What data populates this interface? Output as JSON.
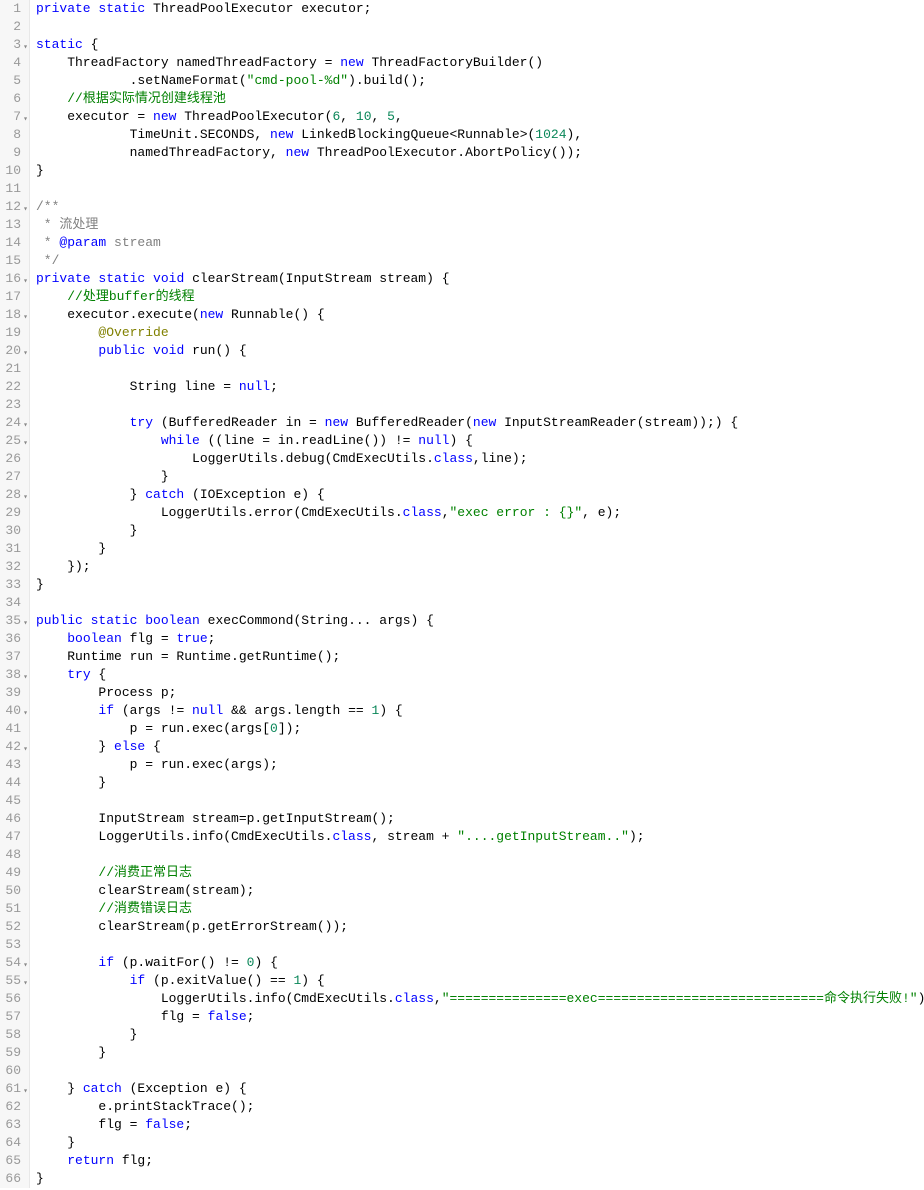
{
  "lines": [
    {
      "n": 1,
      "fold": "",
      "seg": [
        [
          "kw",
          "private"
        ],
        [
          "id",
          " "
        ],
        [
          "kw",
          "static"
        ],
        [
          "id",
          " ThreadPoolExecutor executor;"
        ]
      ]
    },
    {
      "n": 2,
      "fold": "",
      "seg": [
        [
          "id",
          ""
        ]
      ]
    },
    {
      "n": 3,
      "fold": "▾",
      "seg": [
        [
          "kw",
          "static"
        ],
        [
          "id",
          " {"
        ]
      ]
    },
    {
      "n": 4,
      "fold": "",
      "seg": [
        [
          "id",
          "    ThreadFactory namedThreadFactory = "
        ],
        [
          "kw",
          "new"
        ],
        [
          "id",
          " ThreadFactoryBuilder()"
        ]
      ]
    },
    {
      "n": 5,
      "fold": "",
      "seg": [
        [
          "id",
          "            .setNameFormat("
        ],
        [
          "str",
          "\"cmd-pool-%d\""
        ],
        [
          "id",
          ").build();"
        ]
      ]
    },
    {
      "n": 6,
      "fold": "",
      "seg": [
        [
          "id",
          "    "
        ],
        [
          "cmt",
          "//根据实际情况创建线程池"
        ]
      ]
    },
    {
      "n": 7,
      "fold": "▾",
      "seg": [
        [
          "id",
          "    executor = "
        ],
        [
          "kw",
          "new"
        ],
        [
          "id",
          " ThreadPoolExecutor("
        ],
        [
          "num",
          "6"
        ],
        [
          "id",
          ", "
        ],
        [
          "num",
          "10"
        ],
        [
          "id",
          ", "
        ],
        [
          "num",
          "5"
        ],
        [
          "id",
          ","
        ]
      ]
    },
    {
      "n": 8,
      "fold": "",
      "seg": [
        [
          "id",
          "            TimeUnit.SECONDS, "
        ],
        [
          "kw",
          "new"
        ],
        [
          "id",
          " LinkedBlockingQueue<Runnable>("
        ],
        [
          "num",
          "1024"
        ],
        [
          "id",
          "),"
        ]
      ]
    },
    {
      "n": 9,
      "fold": "",
      "seg": [
        [
          "id",
          "            namedThreadFactory, "
        ],
        [
          "kw",
          "new"
        ],
        [
          "id",
          " ThreadPoolExecutor.AbortPolicy());"
        ]
      ]
    },
    {
      "n": 10,
      "fold": "",
      "seg": [
        [
          "id",
          "}"
        ]
      ]
    },
    {
      "n": 11,
      "fold": "",
      "seg": [
        [
          "id",
          ""
        ]
      ]
    },
    {
      "n": 12,
      "fold": "▾",
      "seg": [
        [
          "doc",
          "/**"
        ]
      ]
    },
    {
      "n": 13,
      "fold": "",
      "seg": [
        [
          "doc",
          " * 流处理"
        ]
      ]
    },
    {
      "n": 14,
      "fold": "",
      "seg": [
        [
          "doc",
          " * "
        ],
        [
          "doctag",
          "@param"
        ],
        [
          "doc",
          " stream"
        ]
      ]
    },
    {
      "n": 15,
      "fold": "",
      "seg": [
        [
          "doc",
          " */"
        ]
      ]
    },
    {
      "n": 16,
      "fold": "▾",
      "seg": [
        [
          "kw",
          "private"
        ],
        [
          "id",
          " "
        ],
        [
          "kw",
          "static"
        ],
        [
          "id",
          " "
        ],
        [
          "kw",
          "void"
        ],
        [
          "id",
          " clearStream(InputStream stream) {"
        ]
      ]
    },
    {
      "n": 17,
      "fold": "",
      "seg": [
        [
          "id",
          "    "
        ],
        [
          "cmt",
          "//处理buffer的线程"
        ]
      ]
    },
    {
      "n": 18,
      "fold": "▾",
      "seg": [
        [
          "id",
          "    executor.execute("
        ],
        [
          "kw",
          "new"
        ],
        [
          "id",
          " Runnable() {"
        ]
      ]
    },
    {
      "n": 19,
      "fold": "",
      "seg": [
        [
          "id",
          "        "
        ],
        [
          "ann",
          "@Override"
        ]
      ]
    },
    {
      "n": 20,
      "fold": "▾",
      "seg": [
        [
          "id",
          "        "
        ],
        [
          "kw",
          "public"
        ],
        [
          "id",
          " "
        ],
        [
          "kw",
          "void"
        ],
        [
          "id",
          " run() {"
        ]
      ]
    },
    {
      "n": 21,
      "fold": "",
      "seg": [
        [
          "id",
          ""
        ]
      ]
    },
    {
      "n": 22,
      "fold": "",
      "seg": [
        [
          "id",
          "            String line = "
        ],
        [
          "kw",
          "null"
        ],
        [
          "id",
          ";"
        ]
      ]
    },
    {
      "n": 23,
      "fold": "",
      "seg": [
        [
          "id",
          ""
        ]
      ]
    },
    {
      "n": 24,
      "fold": "▾",
      "seg": [
        [
          "id",
          "            "
        ],
        [
          "kw",
          "try"
        ],
        [
          "id",
          " (BufferedReader in = "
        ],
        [
          "kw",
          "new"
        ],
        [
          "id",
          " BufferedReader("
        ],
        [
          "kw",
          "new"
        ],
        [
          "id",
          " InputStreamReader(stream));) {"
        ]
      ]
    },
    {
      "n": 25,
      "fold": "▾",
      "seg": [
        [
          "id",
          "                "
        ],
        [
          "kw",
          "while"
        ],
        [
          "id",
          " ((line = in.readLine()) != "
        ],
        [
          "kw",
          "null"
        ],
        [
          "id",
          ") {"
        ]
      ]
    },
    {
      "n": 26,
      "fold": "",
      "seg": [
        [
          "id",
          "                    LoggerUtils.debug(CmdExecUtils."
        ],
        [
          "kw",
          "class"
        ],
        [
          "id",
          ",line);"
        ]
      ]
    },
    {
      "n": 27,
      "fold": "",
      "seg": [
        [
          "id",
          "                }"
        ]
      ]
    },
    {
      "n": 28,
      "fold": "▾",
      "seg": [
        [
          "id",
          "            } "
        ],
        [
          "kw",
          "catch"
        ],
        [
          "id",
          " (IOException e) {"
        ]
      ]
    },
    {
      "n": 29,
      "fold": "",
      "seg": [
        [
          "id",
          "                LoggerUtils.error(CmdExecUtils."
        ],
        [
          "kw",
          "class"
        ],
        [
          "id",
          ","
        ],
        [
          "str",
          "\"exec error : {}\""
        ],
        [
          "id",
          ", e);"
        ]
      ]
    },
    {
      "n": 30,
      "fold": "",
      "seg": [
        [
          "id",
          "            }"
        ]
      ]
    },
    {
      "n": 31,
      "fold": "",
      "seg": [
        [
          "id",
          "        }"
        ]
      ]
    },
    {
      "n": 32,
      "fold": "",
      "seg": [
        [
          "id",
          "    });"
        ]
      ]
    },
    {
      "n": 33,
      "fold": "",
      "seg": [
        [
          "id",
          "}"
        ]
      ]
    },
    {
      "n": 34,
      "fold": "",
      "seg": [
        [
          "id",
          ""
        ]
      ]
    },
    {
      "n": 35,
      "fold": "▾",
      "seg": [
        [
          "kw",
          "public"
        ],
        [
          "id",
          " "
        ],
        [
          "kw",
          "static"
        ],
        [
          "id",
          " "
        ],
        [
          "kw",
          "boolean"
        ],
        [
          "id",
          " execCommond(String... args) {"
        ]
      ]
    },
    {
      "n": 36,
      "fold": "",
      "seg": [
        [
          "id",
          "    "
        ],
        [
          "kw",
          "boolean"
        ],
        [
          "id",
          " flg = "
        ],
        [
          "kw",
          "true"
        ],
        [
          "id",
          ";"
        ]
      ]
    },
    {
      "n": 37,
      "fold": "",
      "seg": [
        [
          "id",
          "    Runtime run = Runtime.getRuntime();"
        ]
      ]
    },
    {
      "n": 38,
      "fold": "▾",
      "seg": [
        [
          "id",
          "    "
        ],
        [
          "kw",
          "try"
        ],
        [
          "id",
          " {"
        ]
      ]
    },
    {
      "n": 39,
      "fold": "",
      "seg": [
        [
          "id",
          "        Process p;"
        ]
      ]
    },
    {
      "n": 40,
      "fold": "▾",
      "seg": [
        [
          "id",
          "        "
        ],
        [
          "kw",
          "if"
        ],
        [
          "id",
          " (args != "
        ],
        [
          "kw",
          "null"
        ],
        [
          "id",
          " && args.length == "
        ],
        [
          "num",
          "1"
        ],
        [
          "id",
          ") {"
        ]
      ]
    },
    {
      "n": 41,
      "fold": "",
      "seg": [
        [
          "id",
          "            p = run.exec(args["
        ],
        [
          "num",
          "0"
        ],
        [
          "id",
          "]);"
        ]
      ]
    },
    {
      "n": 42,
      "fold": "▾",
      "seg": [
        [
          "id",
          "        } "
        ],
        [
          "kw",
          "else"
        ],
        [
          "id",
          " {"
        ]
      ]
    },
    {
      "n": 43,
      "fold": "",
      "seg": [
        [
          "id",
          "            p = run.exec(args);"
        ]
      ]
    },
    {
      "n": 44,
      "fold": "",
      "seg": [
        [
          "id",
          "        }"
        ]
      ]
    },
    {
      "n": 45,
      "fold": "",
      "seg": [
        [
          "id",
          ""
        ]
      ]
    },
    {
      "n": 46,
      "fold": "",
      "seg": [
        [
          "id",
          "        InputStream stream=p.getInputStream();"
        ]
      ]
    },
    {
      "n": 47,
      "fold": "",
      "seg": [
        [
          "id",
          "        LoggerUtils.info(CmdExecUtils."
        ],
        [
          "kw",
          "class"
        ],
        [
          "id",
          ", stream + "
        ],
        [
          "str",
          "\"....getInputStream..\""
        ],
        [
          "id",
          ");"
        ]
      ]
    },
    {
      "n": 48,
      "fold": "",
      "seg": [
        [
          "id",
          ""
        ]
      ]
    },
    {
      "n": 49,
      "fold": "",
      "seg": [
        [
          "id",
          "        "
        ],
        [
          "cmt",
          "//消费正常日志"
        ]
      ]
    },
    {
      "n": 50,
      "fold": "",
      "seg": [
        [
          "id",
          "        clearStream(stream);"
        ]
      ]
    },
    {
      "n": 51,
      "fold": "",
      "seg": [
        [
          "id",
          "        "
        ],
        [
          "cmt",
          "//消费错误日志"
        ]
      ]
    },
    {
      "n": 52,
      "fold": "",
      "seg": [
        [
          "id",
          "        clearStream(p.getErrorStream());"
        ]
      ]
    },
    {
      "n": 53,
      "fold": "",
      "seg": [
        [
          "id",
          ""
        ]
      ]
    },
    {
      "n": 54,
      "fold": "▾",
      "seg": [
        [
          "id",
          "        "
        ],
        [
          "kw",
          "if"
        ],
        [
          "id",
          " (p.waitFor() != "
        ],
        [
          "num",
          "0"
        ],
        [
          "id",
          ") {"
        ]
      ]
    },
    {
      "n": 55,
      "fold": "▾",
      "seg": [
        [
          "id",
          "            "
        ],
        [
          "kw",
          "if"
        ],
        [
          "id",
          " (p.exitValue() == "
        ],
        [
          "num",
          "1"
        ],
        [
          "id",
          ") {"
        ]
      ]
    },
    {
      "n": 56,
      "fold": "",
      "seg": [
        [
          "id",
          "                LoggerUtils.info(CmdExecUtils."
        ],
        [
          "kw",
          "class"
        ],
        [
          "id",
          ","
        ],
        [
          "str",
          "\"===============exec=============================命令执行失败!\""
        ],
        [
          "id",
          ");"
        ]
      ]
    },
    {
      "n": 57,
      "fold": "",
      "seg": [
        [
          "id",
          "                flg = "
        ],
        [
          "kw",
          "false"
        ],
        [
          "id",
          ";"
        ]
      ]
    },
    {
      "n": 58,
      "fold": "",
      "seg": [
        [
          "id",
          "            }"
        ]
      ]
    },
    {
      "n": 59,
      "fold": "",
      "seg": [
        [
          "id",
          "        }"
        ]
      ]
    },
    {
      "n": 60,
      "fold": "",
      "seg": [
        [
          "id",
          ""
        ]
      ]
    },
    {
      "n": 61,
      "fold": "▾",
      "seg": [
        [
          "id",
          "    } "
        ],
        [
          "kw",
          "catch"
        ],
        [
          "id",
          " (Exception e) {"
        ]
      ]
    },
    {
      "n": 62,
      "fold": "",
      "seg": [
        [
          "id",
          "        e.printStackTrace();"
        ]
      ]
    },
    {
      "n": 63,
      "fold": "",
      "seg": [
        [
          "id",
          "        flg = "
        ],
        [
          "kw",
          "false"
        ],
        [
          "id",
          ";"
        ]
      ]
    },
    {
      "n": 64,
      "fold": "",
      "seg": [
        [
          "id",
          "    }"
        ]
      ]
    },
    {
      "n": 65,
      "fold": "",
      "seg": [
        [
          "id",
          "    "
        ],
        [
          "kw",
          "return"
        ],
        [
          "id",
          " flg;"
        ]
      ]
    },
    {
      "n": 66,
      "fold": "",
      "seg": [
        [
          "id",
          "}"
        ]
      ]
    }
  ]
}
